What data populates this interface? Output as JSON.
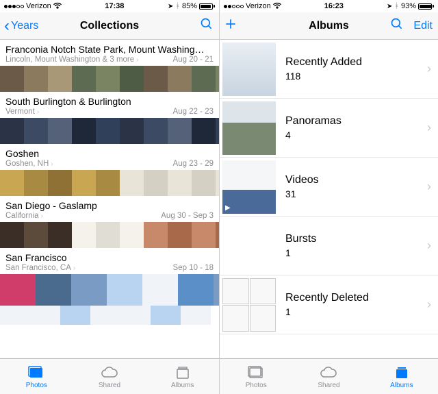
{
  "left": {
    "status": {
      "carrier": "Verizon",
      "time": "17:38",
      "battery_pct": "85%",
      "signal_filled": 3
    },
    "nav": {
      "back_label": "Years",
      "title": "Collections"
    },
    "groups": [
      {
        "title": "Franconia Notch State Park, Mount Washing…",
        "location": "Lincoln, Mount Washington & 3 more",
        "date": "Aug 20 - 21"
      },
      {
        "title": "South Burlington & Burlington",
        "location": "Vermont",
        "date": "Aug 22 - 23"
      },
      {
        "title": "Goshen",
        "location": "Goshen, NH",
        "date": "Aug 23 - 29"
      },
      {
        "title": "San Diego - Gaslamp",
        "location": "California",
        "date": "Aug 30 - Sep 3"
      },
      {
        "title": "San Francisco",
        "location": "San Francisco, CA",
        "date": "Sep 10 - 18"
      }
    ],
    "tabs": {
      "photos": "Photos",
      "shared": "Shared",
      "albums": "Albums",
      "active": "photos"
    }
  },
  "right": {
    "status": {
      "carrier": "Verizon",
      "time": "16:23",
      "battery_pct": "93%",
      "signal_filled": 2
    },
    "nav": {
      "title": "Albums",
      "edit_label": "Edit"
    },
    "albums": [
      {
        "name": "Recently Added",
        "count": "118"
      },
      {
        "name": "Panoramas",
        "count": "4"
      },
      {
        "name": "Videos",
        "count": "31"
      },
      {
        "name": "Bursts",
        "count": "1"
      },
      {
        "name": "Recently Deleted",
        "count": "1"
      }
    ],
    "tabs": {
      "photos": "Photos",
      "shared": "Shared",
      "albums": "Albums",
      "active": "albums"
    }
  }
}
